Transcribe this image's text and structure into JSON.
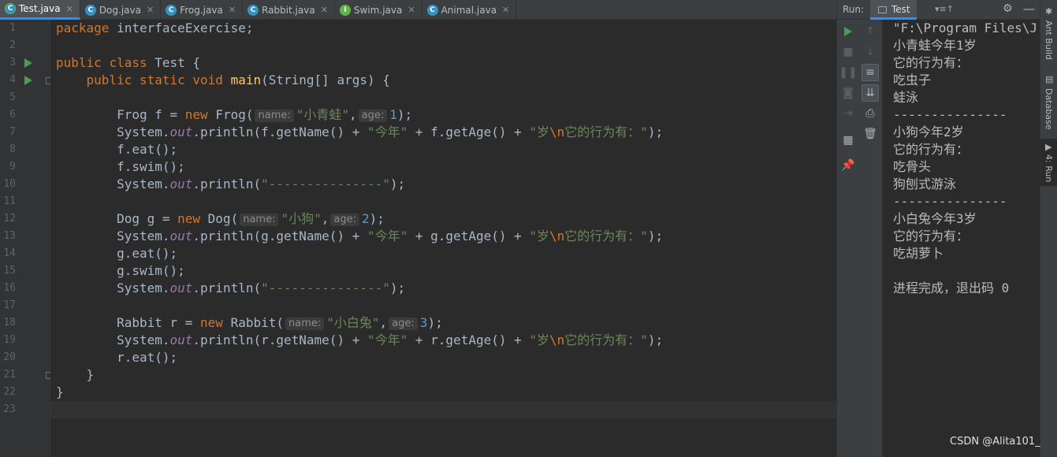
{
  "tabs": [
    {
      "name": "Test.java",
      "icon": "main-class-icon",
      "active": true
    },
    {
      "name": "Dog.java",
      "icon": "class-icon"
    },
    {
      "name": "Frog.java",
      "icon": "class-icon"
    },
    {
      "name": "Rabbit.java",
      "icon": "class-icon"
    },
    {
      "name": "Swim.java",
      "icon": "interface-icon"
    },
    {
      "name": "Animal.java",
      "icon": "abstract-class-icon"
    }
  ],
  "colors": {
    "background": "#2b2b2b",
    "keyword": "#cc7832",
    "string": "#6a8759",
    "number": "#6897bb",
    "method": "#ffc66d",
    "static_field": "#9876aa",
    "run_green": "#499c54",
    "accent_blue": "#4a88c7"
  },
  "code": {
    "line_numbers": [
      "1",
      "2",
      "3",
      "4",
      "5",
      "6",
      "7",
      "8",
      "9",
      "10",
      "11",
      "12",
      "13",
      "14",
      "15",
      "16",
      "17",
      "18",
      "19",
      "20",
      "21",
      "22",
      "23"
    ],
    "t": {
      "package": "package",
      "pkg": "interfaceExercise",
      "public": "public",
      "class": "class",
      "test": "Test",
      "static": "static",
      "void": "void",
      "main": "main",
      "args": "String[] args",
      "new": "new",
      "system": "System.",
      "out": "out",
      "println": ".println(",
      "frog_decl": "Frog f = ",
      "frog_ctor": "Frog(",
      "dog_decl": "Dog g = ",
      "dog_ctor": "Dog(",
      "rabbit_decl": "Rabbit r = ",
      "rabbit_ctor": "Rabbit(",
      "name_hint": "name:",
      "age_hint": "age:",
      "frog_name": "\"小青蛙\"",
      "dog_name": "\"小狗\"",
      "rabbit_name": "\"小白兔\"",
      "age1": "1",
      "age2": "2",
      "age3": "3",
      "f_getname": "f.getName() + ",
      "f_getage": " + f.getAge() + ",
      "g_getname": "g.getName() + ",
      "g_getage": " + g.getAge() + ",
      "r_getname": "r.getName() + ",
      "r_getage": " + r.getAge() + ",
      "jin_nian": "\"今年\"",
      "sui_open": "\"岁",
      "esc_n": "\\n",
      "behavior": "它的行为有：\"",
      "separator": "\"---------------\"",
      "f_eat": "f.eat();",
      "f_swim": "f.swim();",
      "g_eat": "g.eat();",
      "g_swim": "g.swim();",
      "r_eat": "r.eat();"
    }
  },
  "run_panel": {
    "label": "Run:",
    "tab": "Test",
    "options": "▾≡↑",
    "toolbar_icons": [
      "rerun-icon",
      "up-arrow-icon",
      "stop-icon",
      "down-arrow-icon",
      "pause-icon",
      "soft-wrap-icon",
      "camera-icon",
      "scroll-to-end-icon",
      "login-icon",
      "print-icon",
      "trash-icon",
      "layout-icon",
      "pin-icon"
    ]
  },
  "console": {
    "lines": [
      "\"F:\\Program Files\\J",
      "小青蛙今年1岁",
      "它的行为有：",
      "吃虫子",
      "蛙泳",
      "---------------",
      "小狗今年2岁",
      "它的行为有：",
      "吃骨头",
      "狗刨式游泳",
      "---------------",
      "小白兔今年3岁",
      "它的行为有：",
      "吃胡萝卜",
      "",
      "进程完成，退出码 0"
    ]
  },
  "right_strip": {
    "ant_build": "Ant Build",
    "database": "Database",
    "run": "4: Run"
  },
  "watermark": "CSDN @Alita101_"
}
